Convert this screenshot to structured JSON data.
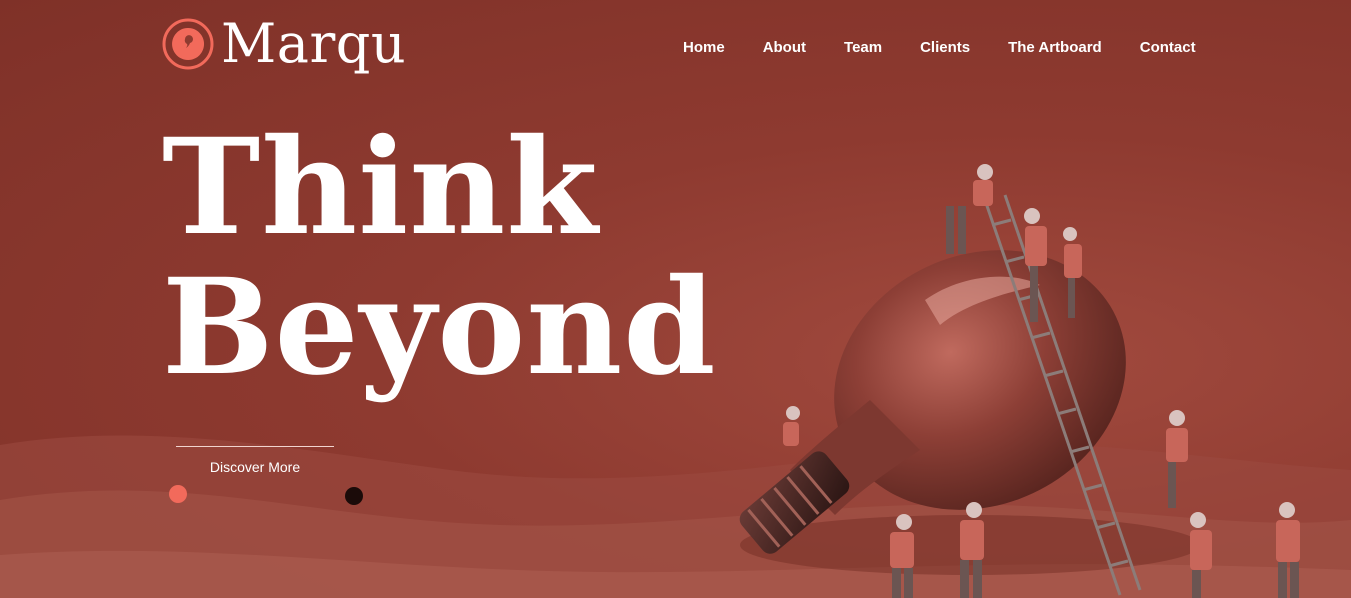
{
  "brand": {
    "name": "Marqu",
    "accent_color": "#f26a5b",
    "icon": "speech-bubble-circle-icon"
  },
  "nav": {
    "items": [
      {
        "label": "Home"
      },
      {
        "label": "About"
      },
      {
        "label": "Team"
      },
      {
        "label": "Clients"
      },
      {
        "label": "The Artboard"
      },
      {
        "label": "Contact"
      }
    ]
  },
  "hero": {
    "headline_line1": "Think",
    "headline_line2": "Beyond",
    "cta_label": "Discover More",
    "background_color": "#8f3b30",
    "slider": {
      "active_dot_color": "#f26a5b",
      "inactive_dot_color": "#1b0b09",
      "slide_count": 2,
      "active_index": 0
    },
    "image": "lightbulb-with-workers-illustration"
  }
}
